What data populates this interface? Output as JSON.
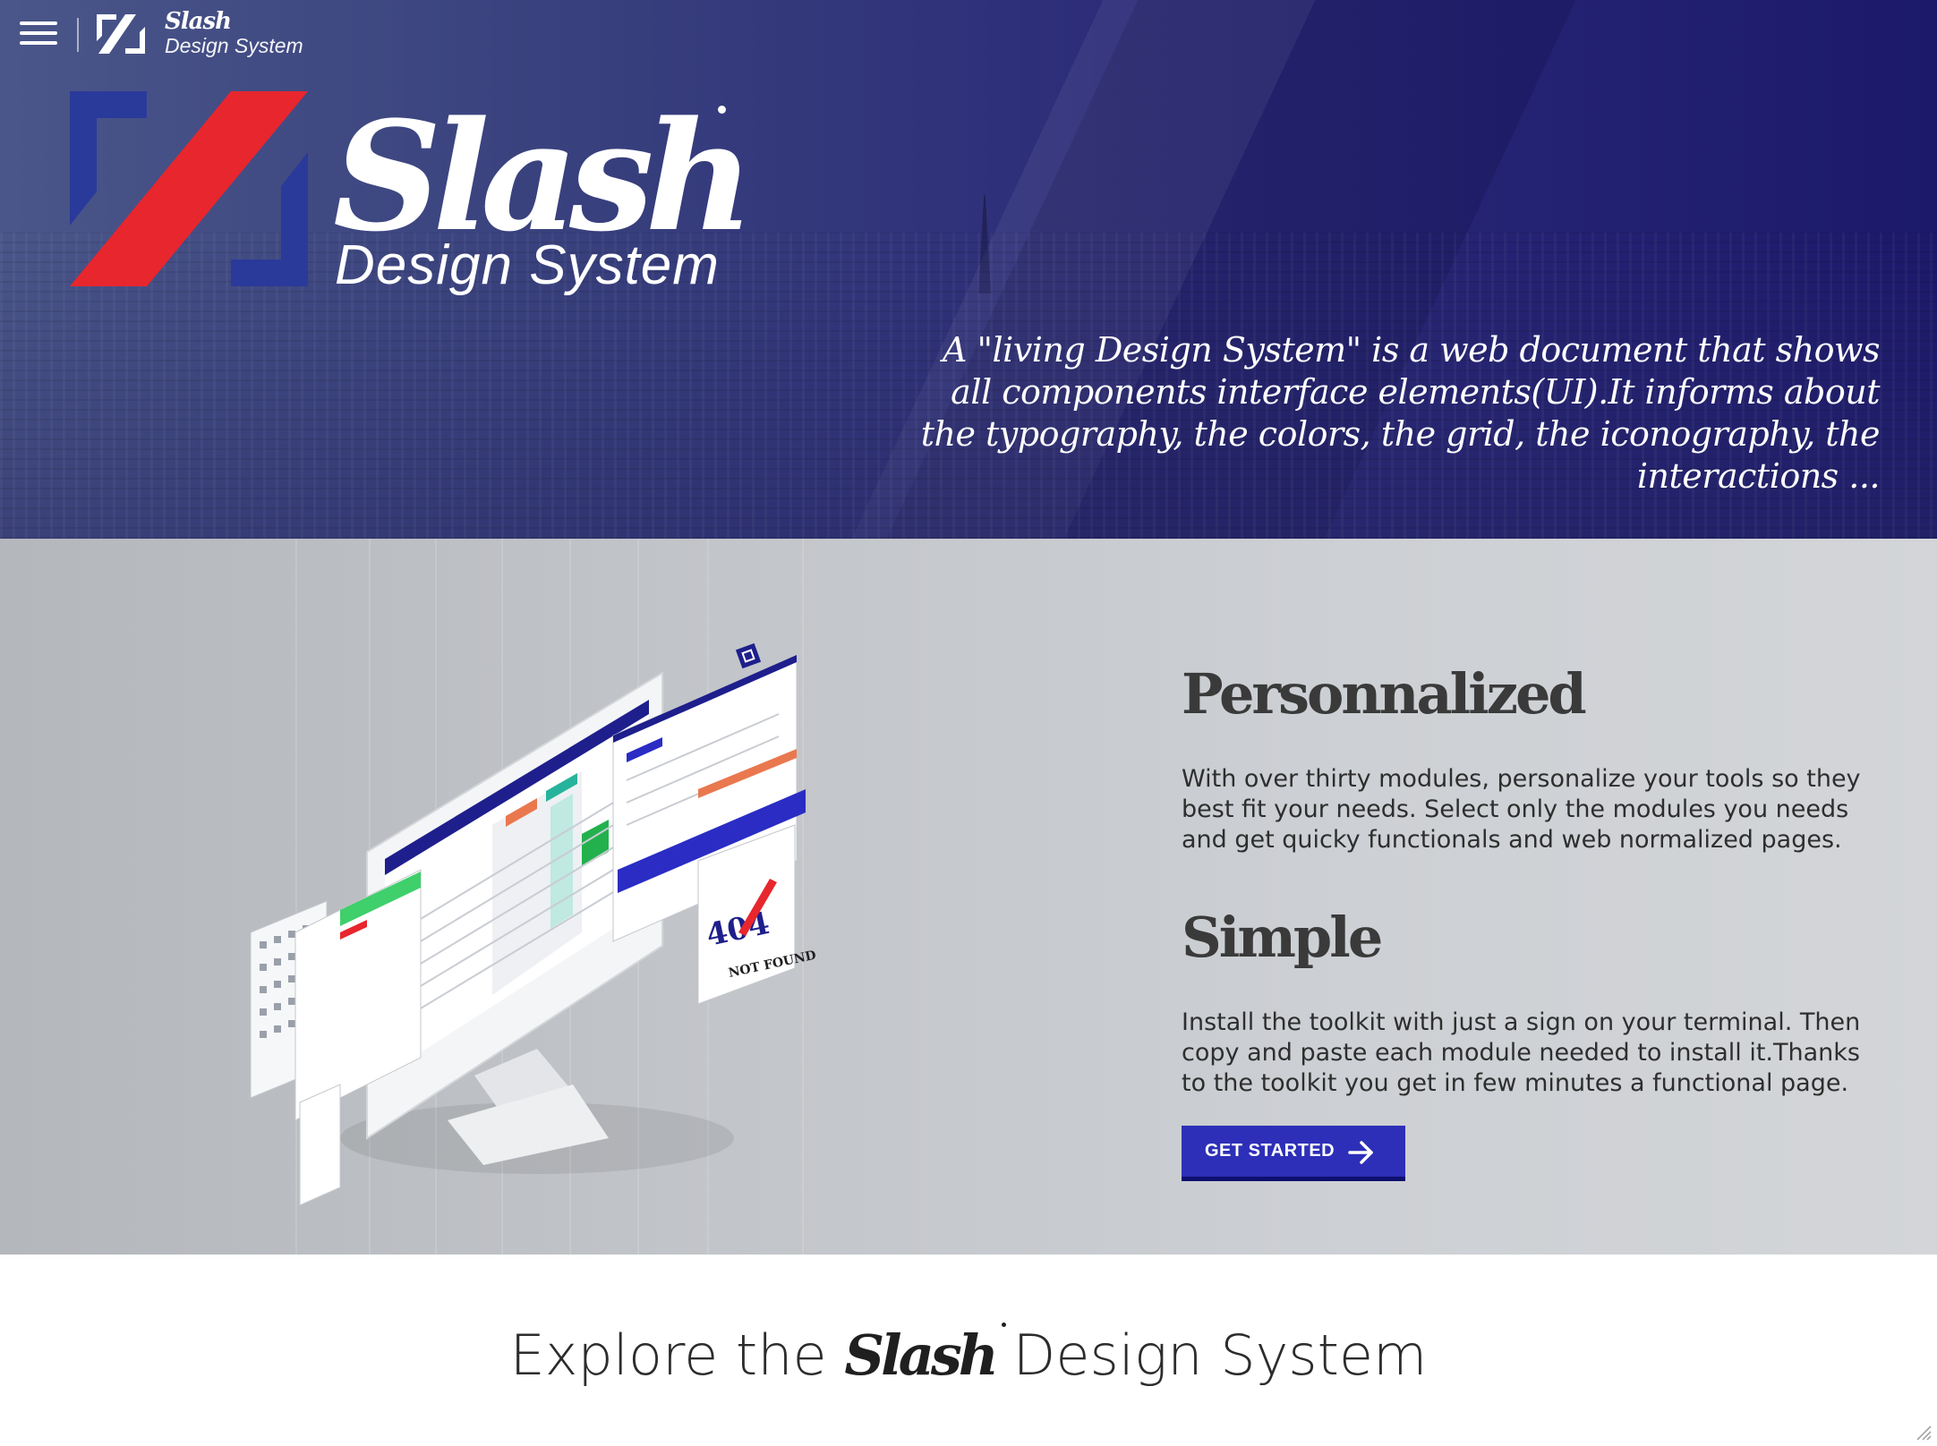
{
  "header": {
    "menu_icon": "hamburger-icon",
    "logo_icon": "slash-logo-icon",
    "brand_name": "Slash",
    "brand_sub": "Design System"
  },
  "hero": {
    "brand_name": "Slash",
    "brand_sub": "Design System",
    "description": "A \"living Design System\" is a web document that shows all components interface elements(UI).It informs about the typography, the colors, the grid, the iconography, the interactions ..."
  },
  "features": {
    "illustration": "design-system-screens-illustration",
    "items": [
      {
        "title": "Personnalized",
        "text": "With over thirty modules, personalize your tools so they best fit your needs. Select only the modules you needs and get quicky functionals and web normalized pages."
      },
      {
        "title": "Simple",
        "text": "Install the toolkit with just a sign on your terminal. Then copy and paste each module needed to install it.Thanks to the toolkit you get in few minutes a functional page."
      }
    ],
    "cta_label": "GET STARTED",
    "cta_icon": "arrow-right-icon"
  },
  "explore": {
    "prefix": "Explore the",
    "brand": "Slash",
    "suffix": "Design System"
  },
  "mock": {
    "not_found_code": "404",
    "not_found_text": "NOT FOUND"
  },
  "colors": {
    "hero_dark": "#1c196b",
    "accent_red": "#e8262d",
    "logo_blue": "#2a3a9a",
    "cta_blue": "#2d2fb8",
    "cta_border": "#0e0f6e",
    "section_gray": "#c3c6ca"
  }
}
